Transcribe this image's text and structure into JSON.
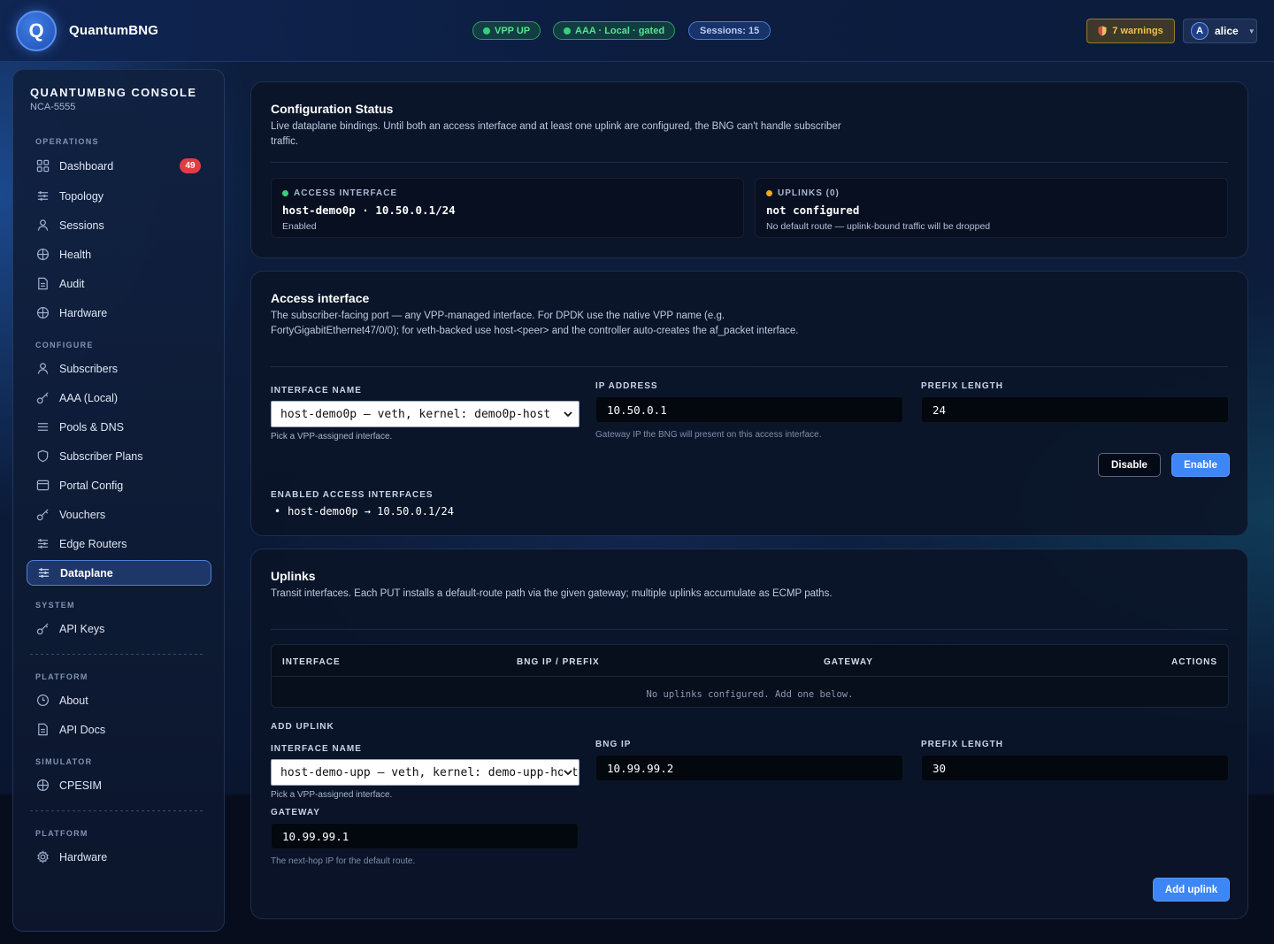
{
  "app": {
    "logo_letter": "Q",
    "name": "QuantumBNG"
  },
  "status_pills": {
    "vpp": "VPP UP",
    "aaa": "AAA · Local · gated",
    "sessions": "Sessions: 15"
  },
  "header": {
    "warnings": "7 warnings",
    "user_initial": "A",
    "user_name": "alice"
  },
  "sidebar": {
    "title": "QUANTUMBNG CONSOLE",
    "subtitle": "NCA-5555",
    "sections": {
      "operations": "OPERATIONS",
      "configure": "CONFIGURE",
      "system": "SYSTEM",
      "platform1": "PLATFORM",
      "simulator": "SIMULATOR",
      "platform2": "PLATFORM"
    },
    "items": {
      "dashboard": "Dashboard",
      "dashboard_badge": "49",
      "topology": "Topology",
      "sessions": "Sessions",
      "health": "Health",
      "audit": "Audit",
      "hardware": "Hardware",
      "subscribers": "Subscribers",
      "aaa_local": "AAA (Local)",
      "pools_dns": "Pools & DNS",
      "subscriber_plans": "Subscriber Plans",
      "portal_config": "Portal Config",
      "vouchers": "Vouchers",
      "edge_routers": "Edge Routers",
      "dataplane": "Dataplane",
      "api_keys": "API Keys",
      "about": "About",
      "api_docs": "API Docs",
      "cpesim": "CPESIM",
      "platform_hardware": "Hardware"
    }
  },
  "config_status": {
    "title": "Configuration Status",
    "description": "Live dataplane bindings. Until both an access interface and at least one uplink are configured, the BNG can't handle subscriber traffic.",
    "access": {
      "label": "ACCESS INTERFACE",
      "value": "host-demo0p · 10.50.0.1/24",
      "note": "Enabled"
    },
    "uplinks": {
      "label": "UPLINKS (0)",
      "value": "not configured",
      "note": "No default route — uplink-bound traffic will be dropped"
    }
  },
  "access_interface": {
    "title": "Access interface",
    "description": "The subscriber-facing port — any VPP-managed interface. For DPDK use the native VPP name (e.g. FortyGigabitEthernet47/0/0); for veth-backed use host-<peer> and the controller auto-creates the af_packet interface.",
    "interface_label": "INTERFACE NAME",
    "interface_value": "host-demo0p — veth, kernel: demo0p-host",
    "interface_hint": "Pick a VPP-assigned interface.",
    "ip_label": "IP ADDRESS",
    "ip_value": "10.50.0.1",
    "ip_hint": "Gateway IP the BNG will present on this access interface.",
    "prefix_label": "PREFIX LENGTH",
    "prefix_value": "24",
    "disable_label": "Disable",
    "enable_label": "Enable",
    "enabled_list_label": "ENABLED ACCESS INTERFACES",
    "enabled_list": [
      "host-demo0p → 10.50.0.1/24"
    ]
  },
  "uplinks": {
    "title": "Uplinks",
    "description": "Transit interfaces. Each PUT installs a default-route path via the given gateway; multiple uplinks accumulate as ECMP paths.",
    "columns": [
      "INTERFACE",
      "BNG IP / PREFIX",
      "GATEWAY",
      "ACTIONS"
    ],
    "rows": [],
    "empty_text": "No uplinks configured. Add one below.",
    "add_label": "ADD UPLINK",
    "interface_label": "INTERFACE NAME",
    "interface_value": "host-demo-upp — veth, kernel: demo-upp-host",
    "interface_hint": "Pick a VPP-assigned interface.",
    "bng_ip_label": "BNG IP",
    "bng_ip_value": "10.99.99.2",
    "prefix_label": "PREFIX LENGTH",
    "prefix_value": "30",
    "gateway_label": "GATEWAY",
    "gateway_value": "10.99.99.1",
    "gateway_hint": "The next-hop IP for the default route.",
    "add_button": "Add uplink"
  },
  "colors": {
    "accent": "#3d86f5",
    "status_green": "#34d27a",
    "status_orange": "#f5a623",
    "badge_red": "#e23b44",
    "warning_yellow": "#f2c24b"
  }
}
